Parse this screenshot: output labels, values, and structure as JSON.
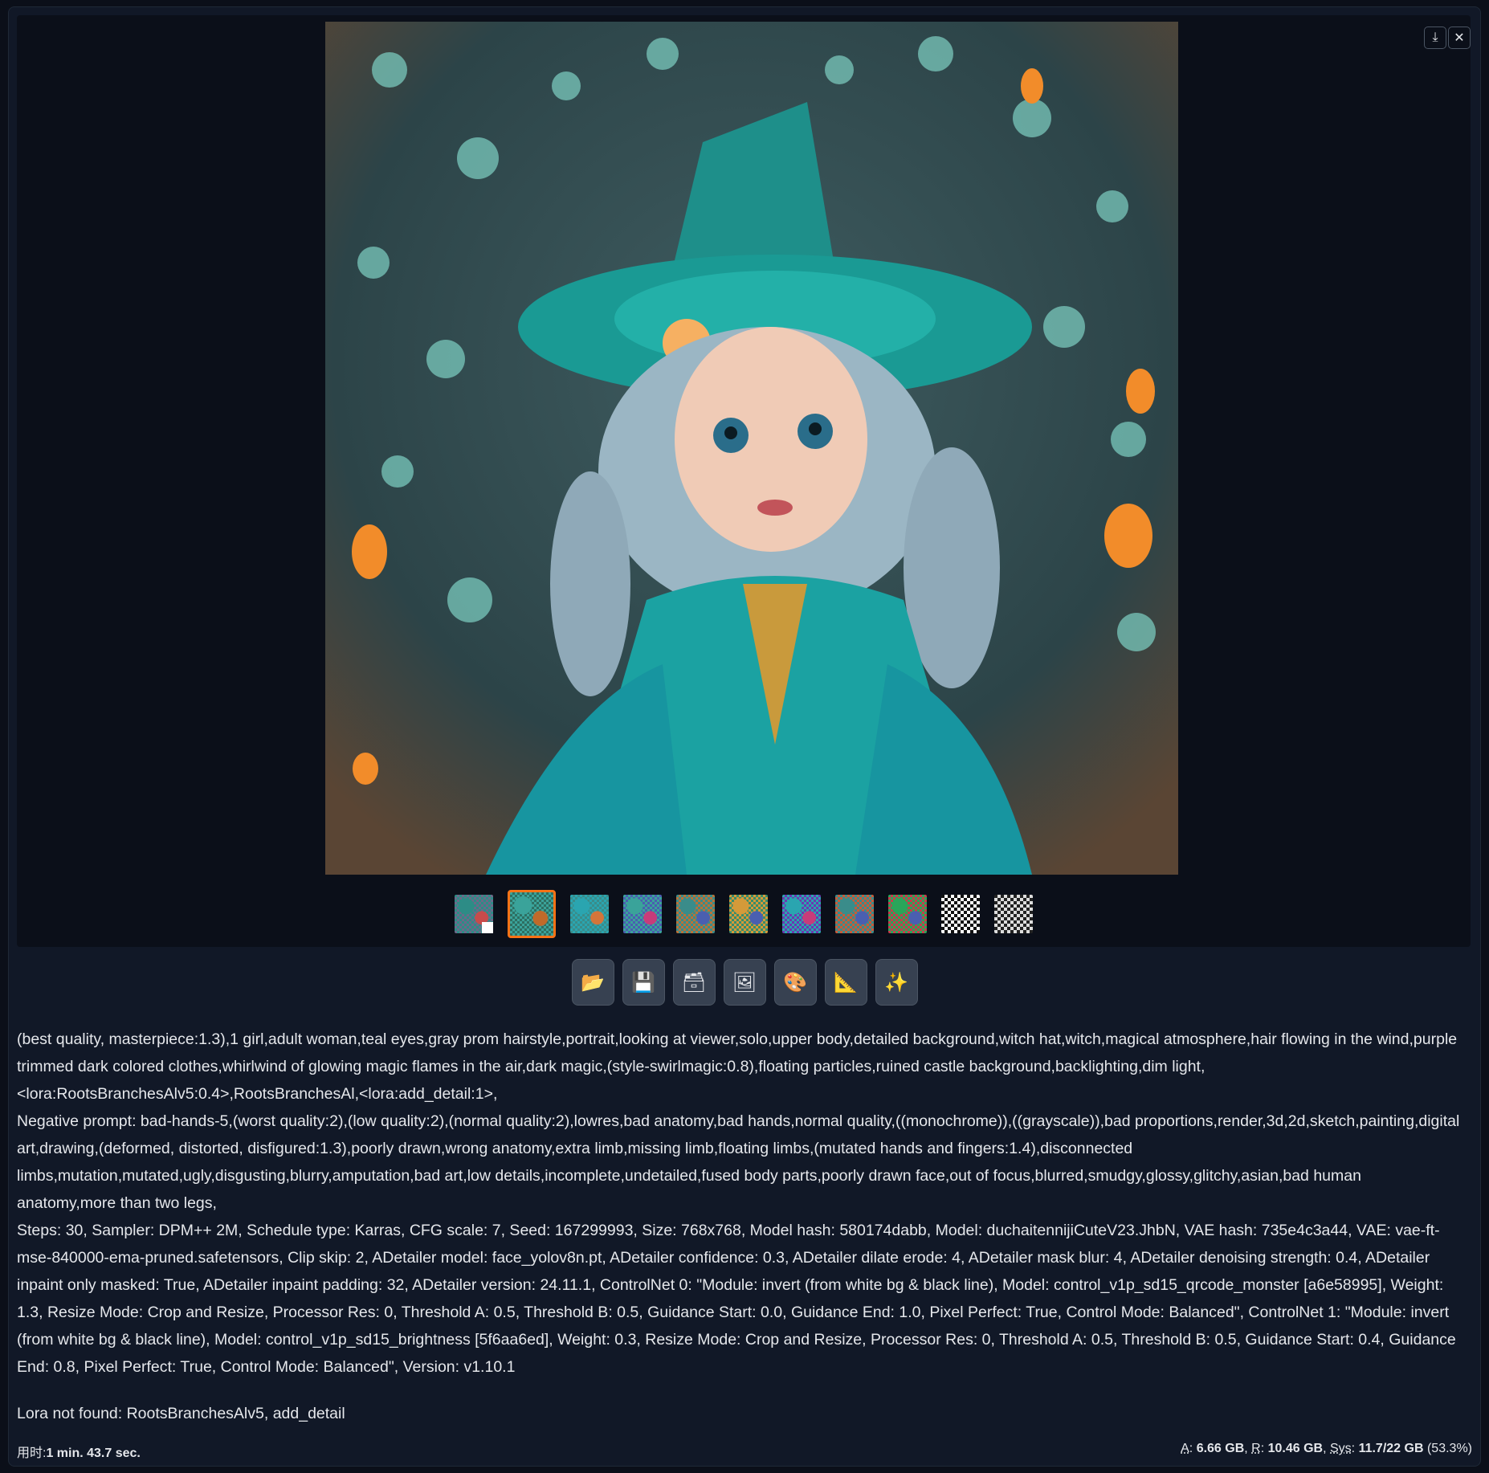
{
  "gallery": {
    "download_icon": "download-icon",
    "close_icon": "close-icon",
    "thumbnails": [
      {
        "colors": [
          "#6b6a8a",
          "#2d8c86",
          "#c84b4b"
        ],
        "has_white_corner": true
      },
      {
        "colors": [
          "#2e6f62",
          "#3aa39a",
          "#c06a2a"
        ],
        "selected": true
      },
      {
        "colors": [
          "#3a8c8a",
          "#2aa5b0",
          "#d4753a"
        ]
      },
      {
        "colors": [
          "#4a5fb0",
          "#3aa39a",
          "#c83c7a"
        ]
      },
      {
        "colors": [
          "#b8723a",
          "#3a8c8a",
          "#4a5fb0"
        ]
      },
      {
        "colors": [
          "#3a8c6a",
          "#d49a3a",
          "#4a5fb0"
        ]
      },
      {
        "colors": [
          "#6a3ab0",
          "#2aa5b0",
          "#c83c7a"
        ]
      },
      {
        "colors": [
          "#c85a3a",
          "#3a8c8a",
          "#4a5fb0"
        ]
      },
      {
        "colors": [
          "#c83c4b",
          "#2aa55a",
          "#4a5fb0"
        ]
      },
      {
        "colors": [
          "#ffffff",
          "#111111"
        ],
        "qr": true
      },
      {
        "colors": [
          "#dddddd",
          "#222222"
        ],
        "qr": true
      }
    ]
  },
  "toolbar": [
    {
      "name": "open-folder-button",
      "glyph": "📂"
    },
    {
      "name": "save-button",
      "glyph": "💾"
    },
    {
      "name": "zip-button",
      "glyph": "🗃"
    },
    {
      "name": "send-to-img2img-button",
      "glyph": "🖼"
    },
    {
      "name": "send-to-inpaint-button",
      "glyph": "🎨"
    },
    {
      "name": "send-to-extras-button",
      "glyph": "📐"
    },
    {
      "name": "upscale-button",
      "glyph": "✨"
    }
  ],
  "generation_info": "(best quality, masterpiece:1.3),1 girl,adult woman,teal eyes,gray prom hairstyle,portrait,looking at viewer,solo,upper body,detailed background,witch hat,witch,magical atmosphere,hair flowing in the wind,purple trimmed dark colored clothes,whirlwind of glowing magic flames in the air,dark magic,(style-swirlmagic:0.8),floating particles,ruined castle background,backlighting,dim light,<lora:RootsBranchesAlv5:0.4>,RootsBranchesAl,<lora:add_detail:1>,\nNegative prompt: bad-hands-5,(worst quality:2),(low quality:2),(normal quality:2),lowres,bad anatomy,bad hands,normal quality,((monochrome)),((grayscale)),bad proportions,render,3d,2d,sketch,painting,digital art,drawing,(deformed, distorted, disfigured:1.3),poorly drawn,wrong anatomy,extra limb,missing limb,floating limbs,(mutated hands and fingers:1.4),disconnected limbs,mutation,mutated,ugly,disgusting,blurry,amputation,bad art,low details,incomplete,undetailed,fused body parts,poorly drawn face,out of focus,blurred,smudgy,glossy,glitchy,asian,bad human anatomy,more than two legs,\nSteps: 30, Sampler: DPM++ 2M, Schedule type: Karras, CFG scale: 7, Seed: 167299993, Size: 768x768, Model hash: 580174dabb, Model: duchaitennijiCuteV23.JhbN, VAE hash: 735e4c3a44, VAE: vae-ft-mse-840000-ema-pruned.safetensors, Clip skip: 2, ADetailer model: face_yolov8n.pt, ADetailer confidence: 0.3, ADetailer dilate erode: 4, ADetailer mask blur: 4, ADetailer denoising strength: 0.4, ADetailer inpaint only masked: True, ADetailer inpaint padding: 32, ADetailer version: 24.11.1, ControlNet 0: \"Module: invert (from white bg & black line), Model: control_v1p_sd15_qrcode_monster [a6e58995], Weight: 1.3, Resize Mode: Crop and Resize, Processor Res: 0, Threshold A: 0.5, Threshold B: 0.5, Guidance Start: 0.0, Guidance End: 1.0, Pixel Perfect: True, Control Mode: Balanced\", ControlNet 1: \"Module: invert (from white bg & black line), Model: control_v1p_sd15_brightness [5f6aa6ed], Weight: 0.3, Resize Mode: Crop and Resize, Processor Res: 0, Threshold A: 0.5, Threshold B: 0.5, Guidance Start: 0.4, Guidance End: 0.8, Pixel Perfect: True, Control Mode: Balanced\", Version: v1.10.1",
  "warning": "Lora not found: RootsBranchesAlv5, add_detail",
  "timing": {
    "label": "用时:",
    "value": "1 min. 43.7 sec."
  },
  "memory": {
    "a_label": "A",
    "a_value": "6.66 GB",
    "r_label": "R",
    "r_value": "10.46 GB",
    "sys_label": "Sys",
    "sys_value": "11.7/22 GB",
    "sys_pct": "(53.3%)"
  }
}
